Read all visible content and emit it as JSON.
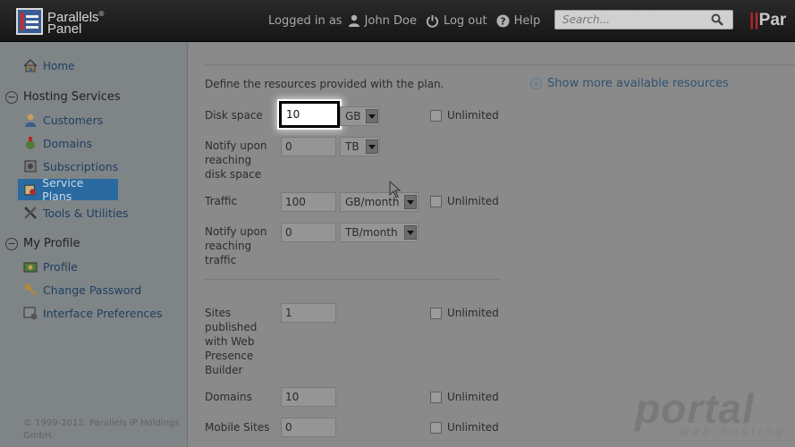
{
  "header": {
    "logo_line1": "Parallels",
    "logo_reg": "®",
    "logo_line2": "Panel",
    "logged_in_as": "Logged in as",
    "user_name": "John Doe",
    "log_out": "Log out",
    "help": "Help",
    "search_placeholder": "Search...",
    "brand_partial_red": "||",
    "brand_partial_text": "Par"
  },
  "sidebar": {
    "home": "Home",
    "hosting_services": "Hosting Services",
    "hosting_items": [
      {
        "label": "Customers",
        "icon": "user-icon"
      },
      {
        "label": "Domains",
        "icon": "domain-icon"
      },
      {
        "label": "Subscriptions",
        "icon": "subscription-icon"
      },
      {
        "label": "Service Plans",
        "icon": "service-plan-icon",
        "active": true
      },
      {
        "label": "Tools & Utilities",
        "icon": "tools-icon"
      }
    ],
    "my_profile": "My Profile",
    "profile_items": [
      {
        "label": "Profile",
        "icon": "profile-icon"
      },
      {
        "label": "Change Password",
        "icon": "key-icon"
      },
      {
        "label": "Interface Preferences",
        "icon": "preferences-icon"
      }
    ],
    "copyright": "© 1999-2012. Parallels IP Holdings GmbH."
  },
  "main": {
    "intro": "Define the resources provided with the plan.",
    "show_more": "Show more available resources",
    "unlimited": "Unlimited",
    "rows": {
      "disk_space": {
        "label": "Disk space",
        "value": "10",
        "unit": "GB"
      },
      "notify_disk": {
        "label": "Notify upon reaching disk space",
        "value": "0",
        "unit": "TB"
      },
      "traffic": {
        "label": "Traffic",
        "value": "100",
        "unit": "GB/month"
      },
      "notify_traffic": {
        "label": "Notify upon reaching traffic",
        "value": "0",
        "unit": "TB/month"
      },
      "sites_wpb": {
        "label": "Sites published with Web Presence Builder",
        "value": "1"
      },
      "domains": {
        "label": "Domains",
        "value": "10"
      },
      "mobile_sites": {
        "label": "Mobile Sites",
        "value": "0"
      }
    }
  },
  "watermark": {
    "main": "portal",
    "sub": "web hosting"
  }
}
